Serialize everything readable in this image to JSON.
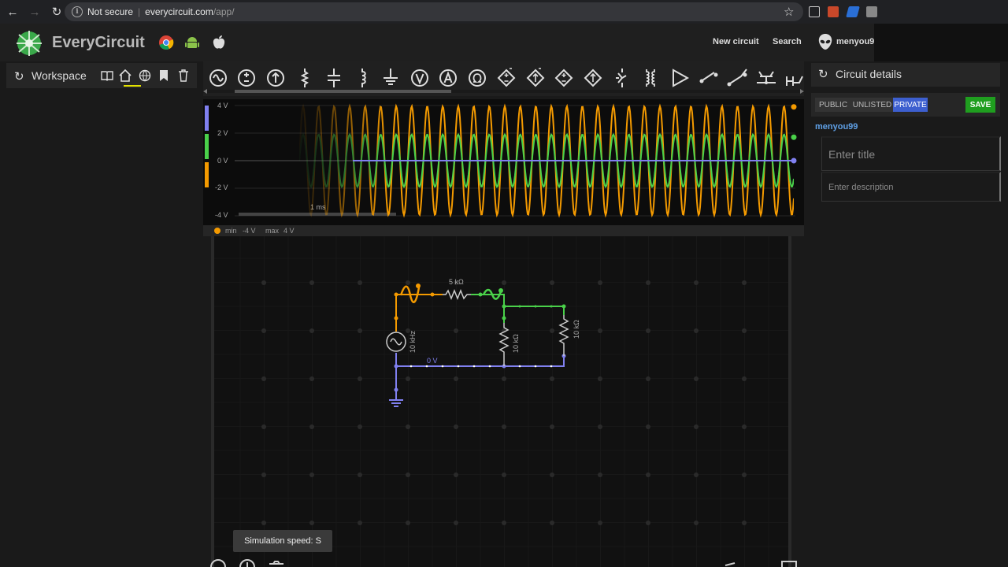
{
  "browser": {
    "security_label": "Not secure",
    "url_host": "everycircuit.com",
    "url_path": "/app/",
    "icons": [
      "back-icon",
      "forward-icon",
      "reload-icon",
      "info-icon",
      "star-icon"
    ]
  },
  "header": {
    "brand": "EveryCircuit",
    "platforms": [
      "chrome-icon",
      "android-icon",
      "apple-icon"
    ],
    "new_circuit": "New circuit",
    "search": "Search",
    "user": "menyou9"
  },
  "workspace": {
    "label": "Workspace",
    "icons": [
      "book-icon",
      "home-icon",
      "globe-icon",
      "bookmark-icon",
      "trash-icon"
    ]
  },
  "toolbar": {
    "tools": [
      "ac-source-icon",
      "dc-source-icon",
      "current-source-icon",
      "resistor-icon",
      "capacitor-icon",
      "inductor-icon",
      "ground-icon",
      "voltmeter-icon",
      "ammeter-icon",
      "ohmmeter-icon",
      "dep-voltage-source-icon",
      "dep-current-source-icon",
      "dep-source-icon",
      "dep-source-2-icon",
      "diode-icon",
      "transformer-icon",
      "opamp-icon",
      "switch-icon",
      "spdt-switch-icon",
      "transistor-icon",
      "probe-icon"
    ]
  },
  "scope": {
    "y_labels": [
      "4 V",
      "2 V",
      "0 V",
      "-2 V",
      "-4 V"
    ],
    "time_label": "1 ms",
    "colors": {
      "blue": "#8080f0",
      "green": "#4ad14a",
      "orange": "#f49a00"
    },
    "legend": {
      "min_label": "min",
      "min_value": "-4 V",
      "max_label": "max",
      "max_value": "4 V"
    }
  },
  "circuit": {
    "resistor_top": "5 kΩ",
    "resistor_mid": "10 kΩ",
    "resistor_right": "10 kΩ",
    "source_freq": "10 kHz",
    "ground_voltage": "0 V"
  },
  "simulation": {
    "speed_label": "Simulation speed: S"
  },
  "details": {
    "title": "Circuit details",
    "visibility": [
      "PUBLIC",
      "UNLISTED",
      "PRIVATE"
    ],
    "selected_visibility": "PRIVATE",
    "save": "SAVE",
    "owner": "menyou99",
    "title_placeholder": "Enter title",
    "desc_placeholder": "Enter description"
  }
}
